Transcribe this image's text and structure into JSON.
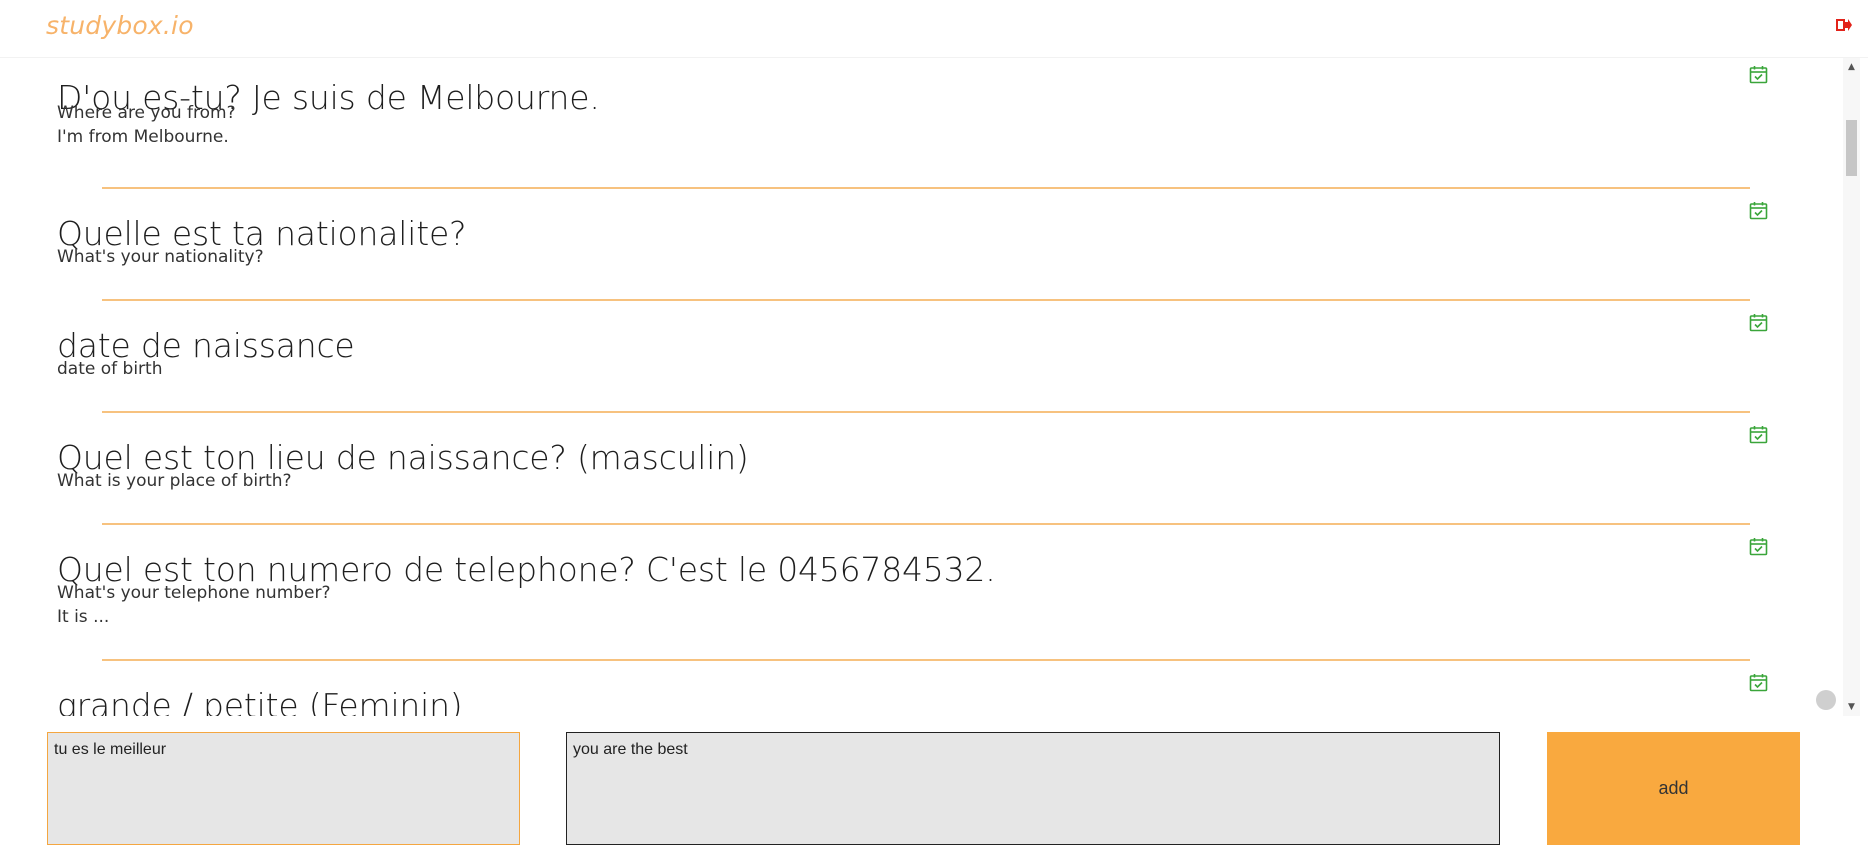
{
  "header": {
    "logo": "studybox.io",
    "logout_icon": "logout-icon"
  },
  "cards": [
    {
      "front": "D'ou es-tu? Je suis de Melbourne.",
      "back_lines": [
        "Where are you from?",
        "I'm from Melbourne."
      ]
    },
    {
      "front": "Quelle est ta nationalite?",
      "back_lines": [
        "What's your nationality?"
      ]
    },
    {
      "front": "date de naissance",
      "back_lines": [
        "date of birth"
      ]
    },
    {
      "front": "Quel est ton lieu de naissance? (masculin)",
      "back_lines": [
        "What is your place of birth?"
      ]
    },
    {
      "front": "Quel est ton numero de telephone? C'est le 0456784532.",
      "back_lines": [
        "What's your telephone number?",
        "It is ..."
      ]
    },
    {
      "front": "grande / petite (Feminin)",
      "back_lines": []
    }
  ],
  "inputs": {
    "front_value": "tu es le meilleur",
    "back_value": "you are the best"
  },
  "add_button_label": "add",
  "colors": {
    "accent": "#f9a93f",
    "logo": "#f7b36a",
    "separator": "#f7c27f",
    "calendar_icon": "#3aa53a",
    "logout_icon": "#e2231a"
  }
}
